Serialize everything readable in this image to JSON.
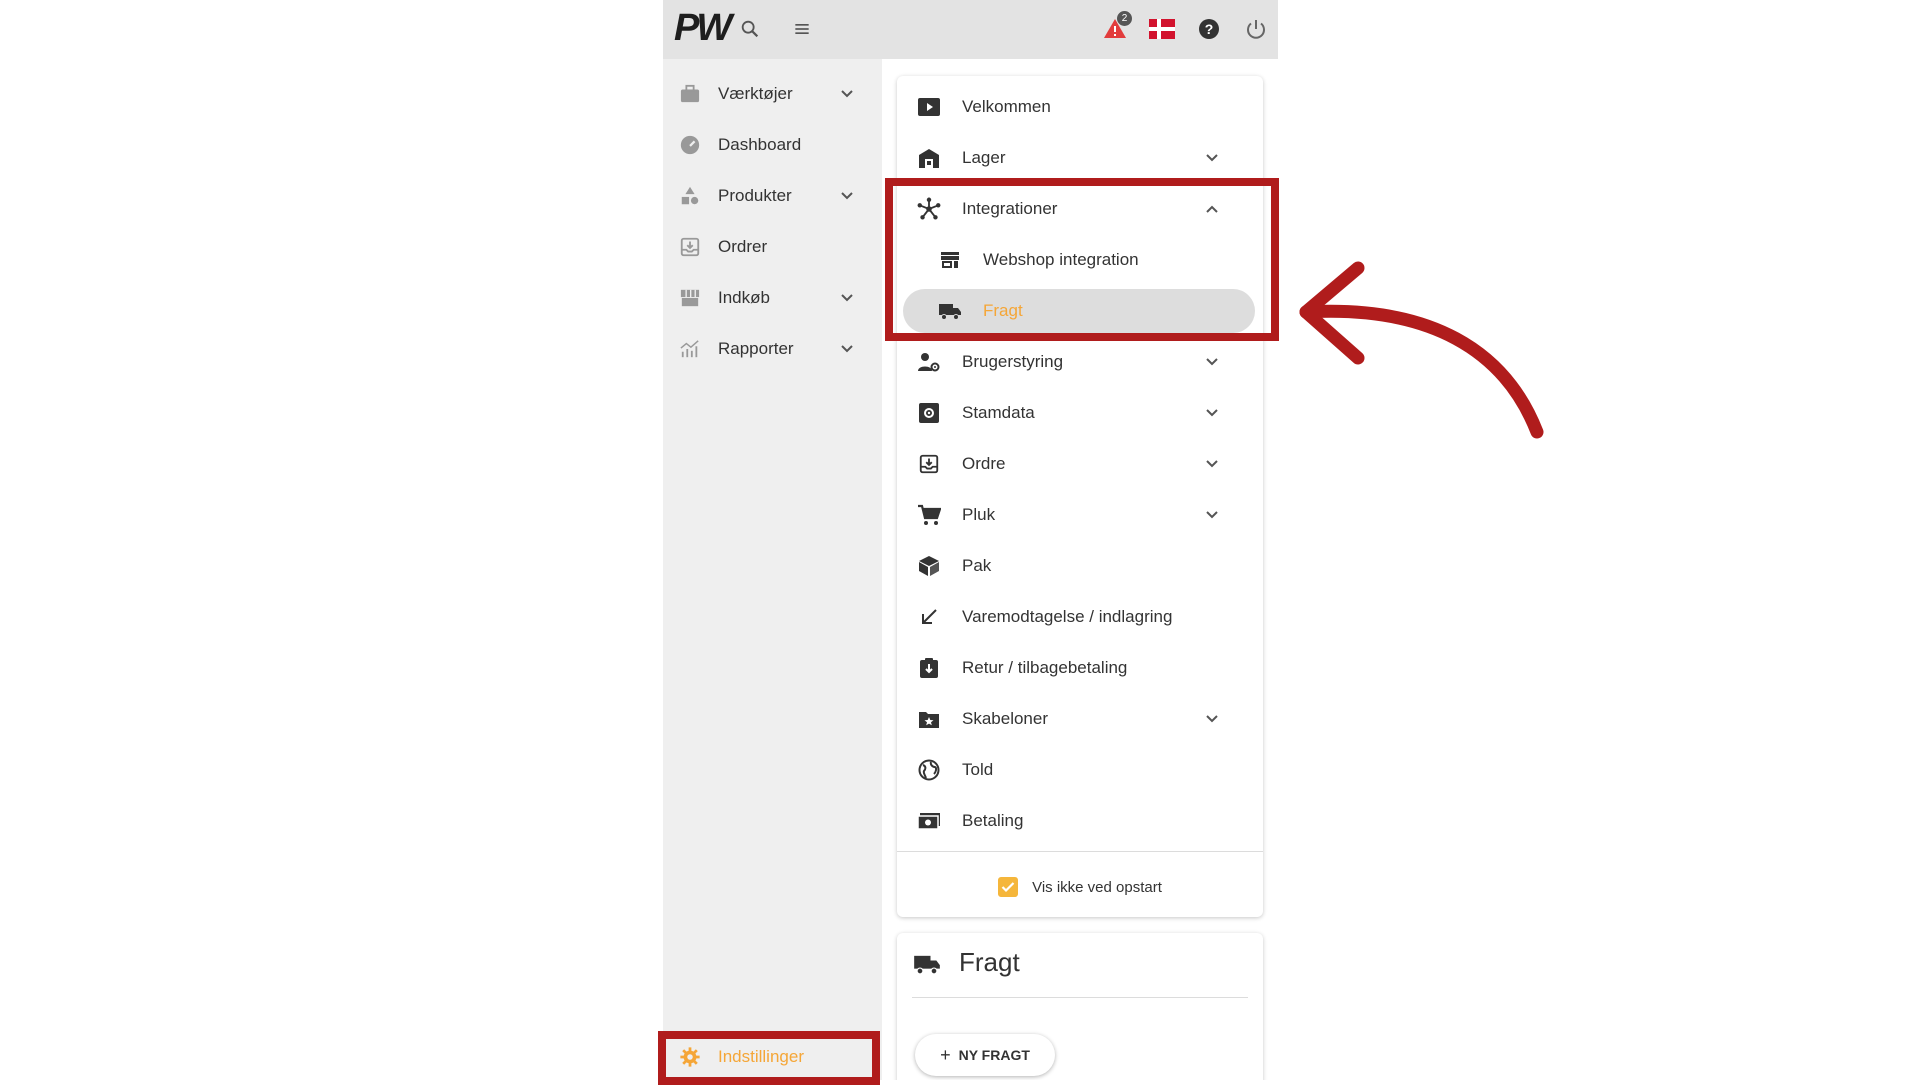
{
  "topbar": {
    "logo_text": "PW",
    "notification_count": "2",
    "icons": [
      "search-icon",
      "menu-icon",
      "warning-icon",
      "danish-flag-icon",
      "help-icon",
      "power-icon"
    ]
  },
  "sidebar": {
    "items": [
      {
        "label": "Værktøjer",
        "icon": "toolbox-icon",
        "has_chevron": true
      },
      {
        "label": "Dashboard",
        "icon": "gauge-icon",
        "has_chevron": false
      },
      {
        "label": "Produkter",
        "icon": "shapes-icon",
        "has_chevron": true
      },
      {
        "label": "Ordrer",
        "icon": "inbox-icon",
        "has_chevron": false
      },
      {
        "label": "Indkøb",
        "icon": "store-icon",
        "has_chevron": true
      },
      {
        "label": "Rapporter",
        "icon": "chart-icon",
        "has_chevron": true
      }
    ],
    "settings_label": "Indstillinger"
  },
  "settings_menu": {
    "items": [
      {
        "label": "Velkommen",
        "icon": "play-icon"
      },
      {
        "label": "Lager",
        "icon": "warehouse-icon",
        "chevron": "down"
      },
      {
        "label": "Integrationer",
        "icon": "hub-icon",
        "chevron": "up"
      },
      {
        "label": "Webshop integration",
        "icon": "storefront-icon",
        "sub": true
      },
      {
        "label": "Fragt",
        "icon": "truck-icon",
        "sub": true,
        "active": true
      },
      {
        "label": "Brugerstyring",
        "icon": "user-settings-icon",
        "chevron": "down"
      },
      {
        "label": "Stamdata",
        "icon": "gear-box-icon",
        "chevron": "down"
      },
      {
        "label": "Ordre",
        "icon": "inbox-icon",
        "chevron": "down"
      },
      {
        "label": "Pluk",
        "icon": "cart-icon",
        "chevron": "down"
      },
      {
        "label": "Pak",
        "icon": "package-icon"
      },
      {
        "label": "Varemodtagelse / indlagring",
        "icon": "arrow-down-left-icon"
      },
      {
        "label": "Retur / tilbagebetaling",
        "icon": "return-icon"
      },
      {
        "label": "Skabeloner",
        "icon": "folder-star-icon",
        "chevron": "down"
      },
      {
        "label": "Told",
        "icon": "globe-icon"
      },
      {
        "label": "Betaling",
        "icon": "money-icon"
      }
    ],
    "checkbox_label": "Vis ikke ved opstart",
    "checkbox_checked": true
  },
  "fragt_card": {
    "title": "Fragt",
    "button_label": "NY FRAGT"
  },
  "colors": {
    "accent": "#f5a637",
    "annotation": "#b01c1c",
    "sidebar_bg": "#efefef",
    "topbar_bg": "#e3e3e3"
  }
}
